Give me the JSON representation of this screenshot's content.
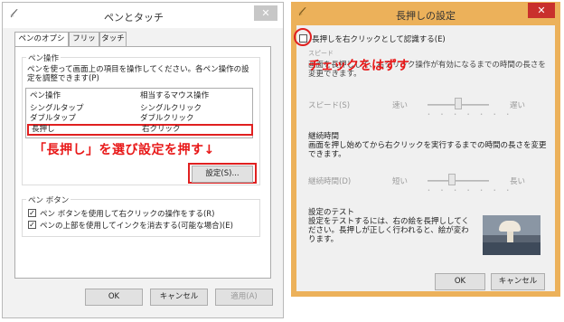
{
  "left_window": {
    "title": "ペンとタッチ",
    "close_glyph": "✕",
    "pen_glyph": "𝓁",
    "tabs": [
      "ペンのオプション",
      "フリック",
      "タッチ"
    ],
    "pen_actions": {
      "group_label": "ペン操作",
      "description": "ペンを使って画面上の項目を操作してください。各ペン操作の設定を調整できます(P)",
      "columns": [
        "ペン操作",
        "相当するマウス操作"
      ],
      "rows": [
        [
          "シングルタップ",
          "シングルクリック"
        ],
        [
          "ダブルタップ",
          "ダブルクリック"
        ],
        [
          "長押し",
          "右クリック"
        ]
      ],
      "settings_button": "設定(S)..."
    },
    "annotation": "「長押し」を選び設定を押す↓",
    "pen_buttons": {
      "group_label": "ペン ボタン",
      "option1": "ペン ボタンを使用して右クリックの操作をする(R)",
      "option2": "ペンの上部を使用してインクを消去する(可能な場合)(E)"
    },
    "buttons": {
      "ok": "OK",
      "cancel": "キャンセル",
      "apply": "適用(A)"
    }
  },
  "right_window": {
    "title": "長押しの設定",
    "close_glyph": "✕",
    "pen_glyph": "𝓁",
    "enable_checkbox": "長押しを右クリックとして認識する(E)",
    "speed": {
      "group_label": "スピード",
      "description": "画面を長押しして、右クリック操作が有効になるまでの時間の長さを変更できます。",
      "label": "スピード(S)",
      "min": "速い",
      "max": "遅い",
      "level": 0.5
    },
    "duration": {
      "group_label": "継続時間",
      "description": "画面を押し始めてから右クリックを実行するまでの時間の長さを変更できます。",
      "label": "継続時間(D)",
      "min": "短い",
      "max": "長い",
      "level": 0.4
    },
    "test": {
      "group_label": "設定のテスト",
      "description": "設定をテストするには、右の絵を長押ししてください。長押しが正しく行われると、絵が変わります。"
    },
    "annotation": "チェックをはずす",
    "buttons": {
      "ok": "OK",
      "cancel": "キャンセル"
    }
  },
  "colors": {
    "annotation_red": "#e81818",
    "title_accent": "#ecb15a",
    "close_red": "#c9302c"
  }
}
